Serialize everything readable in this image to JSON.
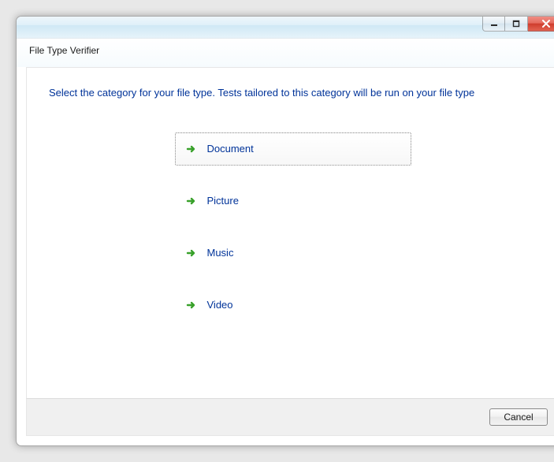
{
  "window": {
    "title": "File Type Verifier"
  },
  "instruction": "Select the category for your file type.  Tests tailored to this category will be run on your file type",
  "choices": [
    {
      "label": "Document",
      "selected": true
    },
    {
      "label": "Picture",
      "selected": false
    },
    {
      "label": "Music",
      "selected": false
    },
    {
      "label": "Video",
      "selected": false
    }
  ],
  "footer": {
    "cancel_label": "Cancel"
  }
}
